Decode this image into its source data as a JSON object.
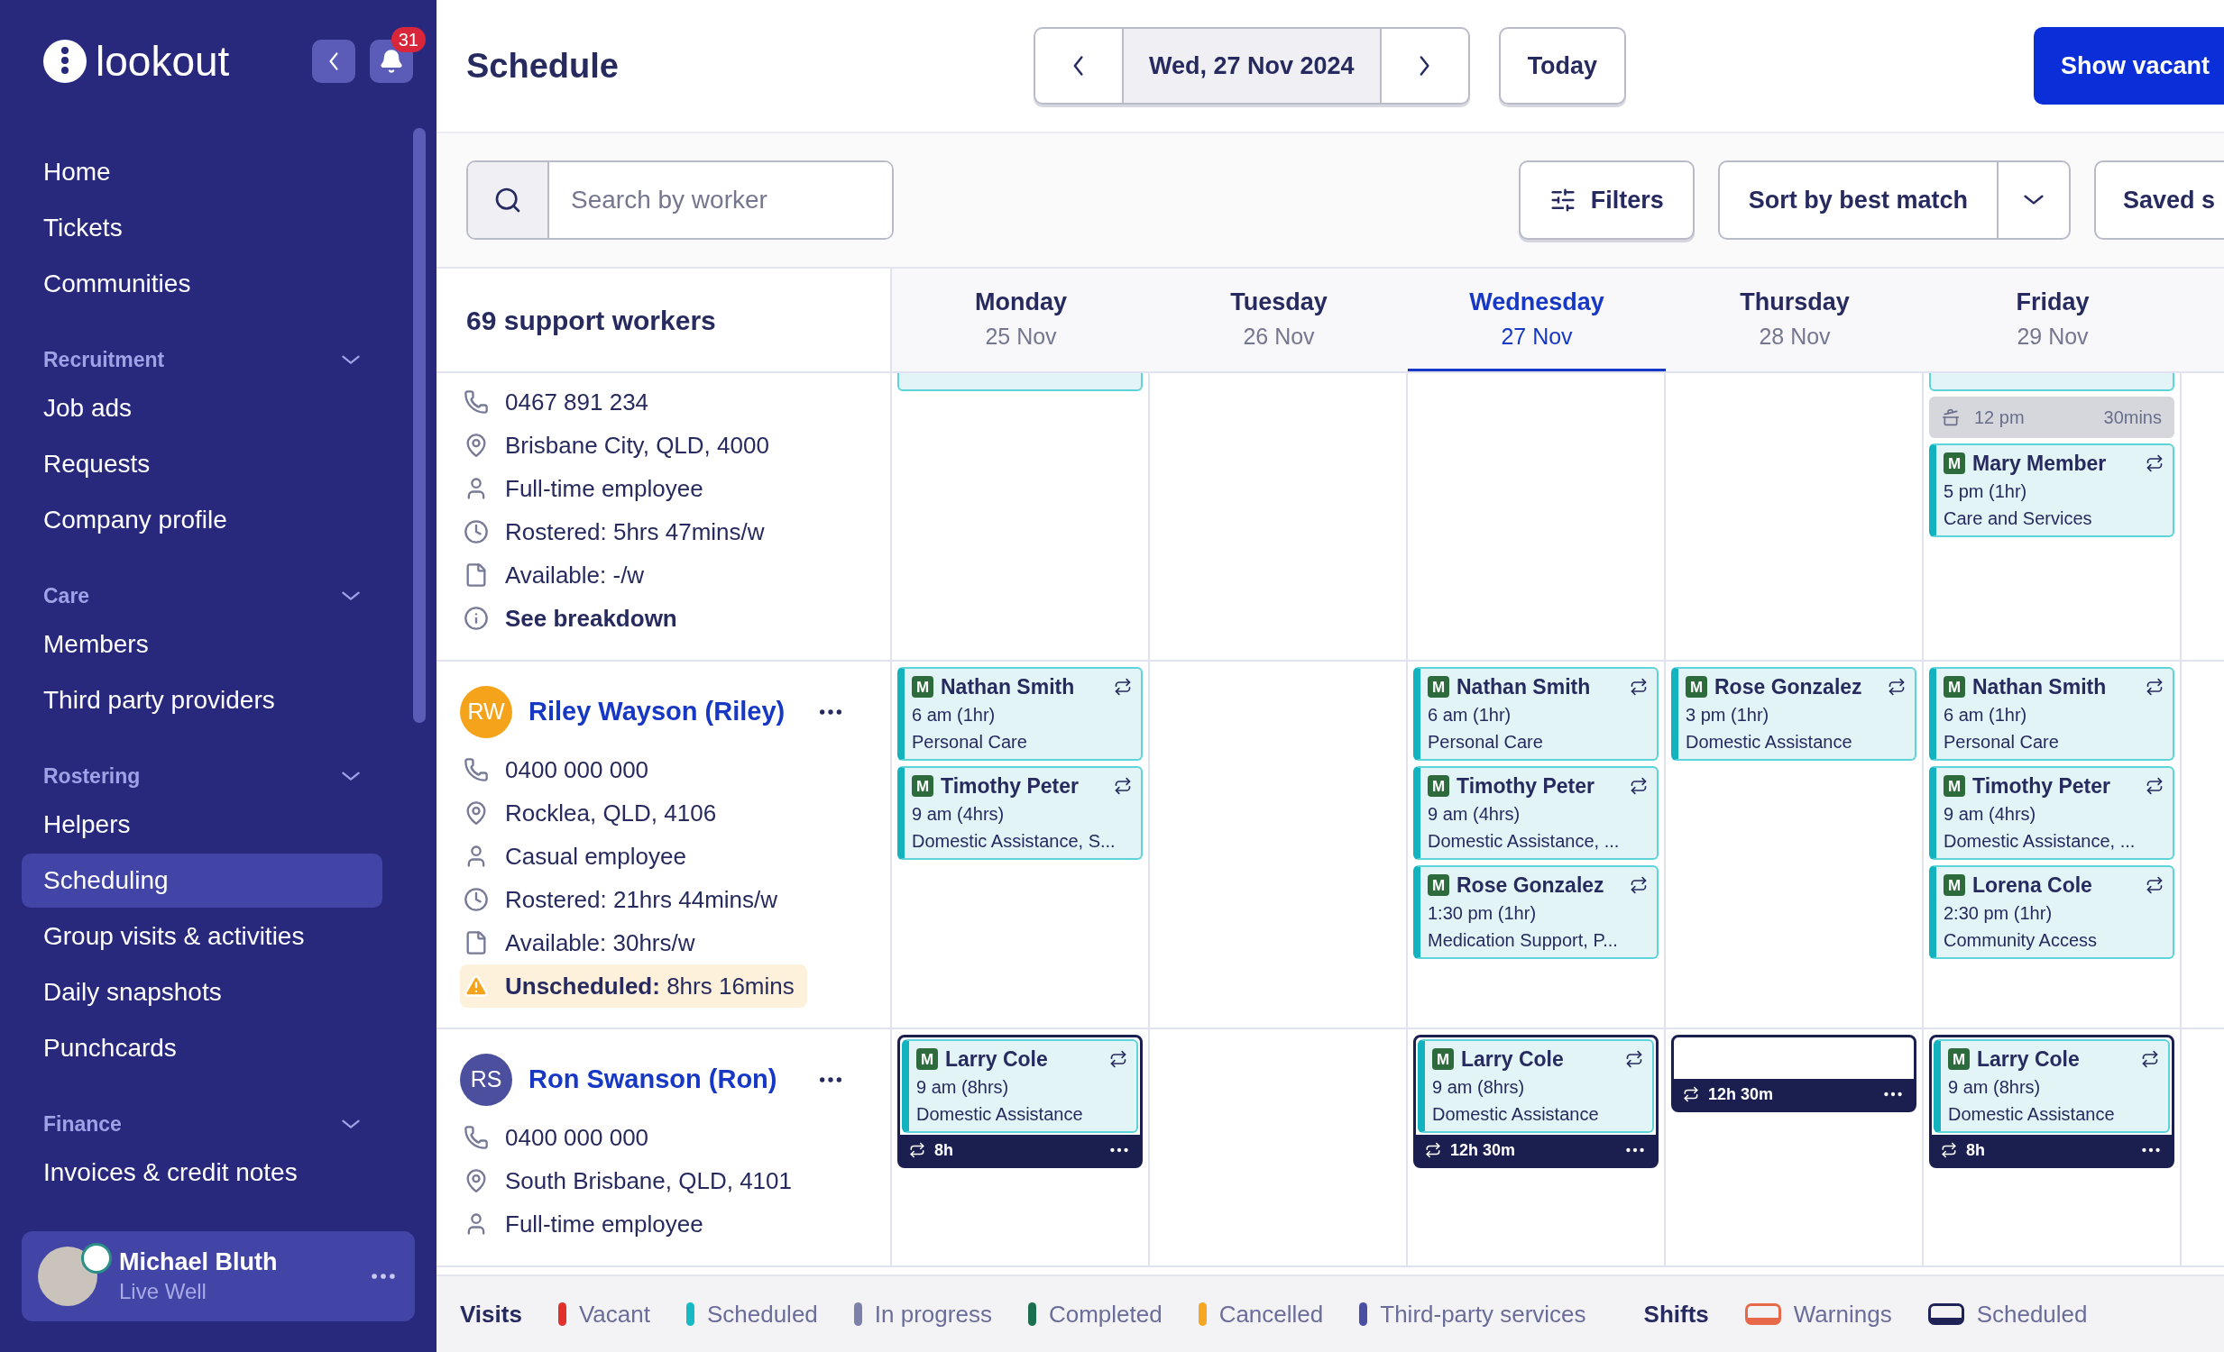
{
  "sidebar": {
    "logo": "lookout",
    "notification_count": "31",
    "sections": [
      {
        "items": [
          {
            "label": "Home",
            "selected": false
          },
          {
            "label": "Tickets",
            "selected": false
          },
          {
            "label": "Communities",
            "selected": false
          }
        ]
      },
      {
        "title": "Recruitment",
        "expanded": true,
        "items": [
          {
            "label": "Job ads",
            "selected": false
          },
          {
            "label": "Requests",
            "selected": false
          },
          {
            "label": "Company profile",
            "selected": false
          }
        ]
      },
      {
        "title": "Care",
        "expanded": true,
        "items": [
          {
            "label": "Members",
            "selected": false
          },
          {
            "label": "Third party providers",
            "selected": false
          }
        ]
      },
      {
        "title": "Rostering",
        "expanded": true,
        "items": [
          {
            "label": "Helpers",
            "selected": false
          },
          {
            "label": "Scheduling",
            "selected": true
          },
          {
            "label": "Group visits & activities",
            "selected": false
          },
          {
            "label": "Daily snapshots",
            "selected": false
          },
          {
            "label": "Punchcards",
            "selected": false
          }
        ]
      },
      {
        "title": "Finance",
        "expanded": true,
        "items": [
          {
            "label": "Invoices & credit notes",
            "selected": false
          }
        ]
      }
    ],
    "user": {
      "name": "Michael Bluth",
      "organisation": "Live Well"
    }
  },
  "header": {
    "title": "Schedule",
    "date": "Wed, 27 Nov 2024",
    "today_button": "Today",
    "primary_button": "Show vacant"
  },
  "toolbar": {
    "search": {
      "placeholder": "Search by worker"
    },
    "filters_button": "Filters",
    "sort": "Sort by best match",
    "saved_button": "Saved s"
  },
  "calendar": {
    "worker_count": "69 support workers",
    "days": [
      {
        "name": "Monday",
        "date": "25 Nov",
        "selected": false
      },
      {
        "name": "Tuesday",
        "date": "26 Nov",
        "selected": false
      },
      {
        "name": "Wednesday",
        "date": "27 Nov",
        "selected": true
      },
      {
        "name": "Thursday",
        "date": "28 Nov",
        "selected": false
      },
      {
        "name": "Friday",
        "date": "29 Nov",
        "selected": false
      }
    ],
    "workers": [
      {
        "details": [
          {
            "kind": "phone",
            "text": "0467 891 234"
          },
          {
            "kind": "location",
            "text": "Brisbane City, QLD, 4000"
          },
          {
            "kind": "person",
            "text": "Full-time employee"
          },
          {
            "kind": "clock",
            "text": "Rostered: 5hrs 47mins/w"
          },
          {
            "kind": "file",
            "text": "Available: -/w"
          },
          {
            "kind": "info",
            "text": "See breakdown"
          }
        ],
        "days": {
          "monday": {
            "entries": [
              {
                "kind": "stub"
              }
            ]
          },
          "friday": {
            "entries": [
              {
                "kind": "stub"
              },
              {
                "kind": "break",
                "time": "12 pm",
                "duration": "30mins"
              },
              {
                "kind": "visit",
                "badge": "M",
                "member": "Mary Member",
                "time": "5 pm (1hr)",
                "service": "Care and Services",
                "recurring": true
              }
            ]
          }
        }
      },
      {
        "initials": "RW",
        "name": "Riley Wayson (Riley)",
        "color": "#f5a31a",
        "details": [
          {
            "kind": "phone",
            "text": "0400 000 000"
          },
          {
            "kind": "location",
            "text": "Rocklea, QLD, 4106"
          },
          {
            "kind": "person",
            "text": "Casual employee"
          },
          {
            "kind": "clock",
            "text": "Rostered: 21hrs 44mins/w"
          },
          {
            "kind": "file",
            "text": "Available: 30hrs/w"
          },
          {
            "kind": "warning",
            "text": "**Unscheduled:** 8hrs 16mins"
          }
        ],
        "days": {
          "monday": {
            "entries": [
              {
                "kind": "visit",
                "badge": "M",
                "member": "Nathan Smith",
                "time": "6 am (1hr)",
                "service": "Personal Care",
                "recurring": true
              },
              {
                "kind": "visit",
                "badge": "M",
                "member": "Timothy Peter",
                "time": "9 am (4hrs)",
                "service": "Domestic Assistance, S...",
                "recurring": true
              }
            ]
          },
          "wednesday": {
            "entries": [
              {
                "kind": "visit",
                "badge": "M",
                "member": "Nathan Smith",
                "time": "6 am (1hr)",
                "service": "Personal Care",
                "recurring": true
              },
              {
                "kind": "visit",
                "badge": "M",
                "member": "Timothy Peter",
                "time": "9 am (4hrs)",
                "service": "Domestic Assistance, ...",
                "recurring": true
              },
              {
                "kind": "visit",
                "badge": "M",
                "member": "Rose Gonzalez",
                "time": "1:30 pm (1hr)",
                "service": "Medication Support, P...",
                "recurring": true
              }
            ]
          },
          "thursday": {
            "entries": [
              {
                "kind": "visit",
                "badge": "M",
                "member": "Rose Gonzalez",
                "time": "3 pm (1hr)",
                "service": "Domestic Assistance",
                "recurring": true
              }
            ]
          },
          "friday": {
            "entries": [
              {
                "kind": "visit",
                "badge": "M",
                "member": "Nathan Smith",
                "time": "6 am (1hr)",
                "service": "Personal Care",
                "recurring": true
              },
              {
                "kind": "visit",
                "badge": "M",
                "member": "Timothy Peter",
                "time": "9 am (4hrs)",
                "service": "Domestic Assistance, ...",
                "recurring": true
              },
              {
                "kind": "visit",
                "badge": "M",
                "member": "Lorena Cole",
                "time": "2:30 pm (1hr)",
                "service": "Community Access",
                "recurring": true
              }
            ]
          }
        }
      },
      {
        "initials": "RS",
        "name": "Ron Swanson (Ron)",
        "color": "#4b4f9e",
        "details": [
          {
            "kind": "phone",
            "text": "0400 000 000"
          },
          {
            "kind": "location",
            "text": "South Brisbane, QLD, 4101"
          },
          {
            "kind": "person",
            "text": "Full-time employee"
          }
        ],
        "days": {
          "monday": {
            "entries": [
              {
                "kind": "shift",
                "duration": "8h",
                "visits": [
                  {
                    "badge": "M",
                    "member": "Larry Cole",
                    "time": "9 am (8hrs)",
                    "service": "Domestic Assistance",
                    "recurring": true
                  }
                ]
              }
            ]
          },
          "wednesday": {
            "entries": [
              {
                "kind": "shift",
                "duration": "12h 30m",
                "visits": [
                  {
                    "badge": "M",
                    "member": "Larry Cole",
                    "time": "9 am (8hrs)",
                    "service": "Domestic Assistance",
                    "recurring": true
                  }
                ]
              }
            ]
          },
          "thursday": {
            "entries": [
              {
                "kind": "shift",
                "duration": "12h 30m"
              }
            ]
          },
          "friday": {
            "entries": [
              {
                "kind": "shift",
                "duration": "8h",
                "visits": [
                  {
                    "badge": "M",
                    "member": "Larry Cole",
                    "time": "9 am (8hrs)",
                    "service": "Domestic Assistance",
                    "recurring": true
                  }
                ]
              }
            ]
          }
        }
      }
    ]
  },
  "legend": {
    "groups": [
      {
        "title": "Visits",
        "items": [
          {
            "label": "Vacant",
            "kind": "bar",
            "color": "#e0322d"
          },
          {
            "label": "Scheduled",
            "kind": "bar",
            "color": "#17b9c4"
          },
          {
            "label": "In progress",
            "kind": "bar",
            "color": "#7d80a8"
          },
          {
            "label": "Completed",
            "kind": "bar",
            "color": "#1b6e50"
          },
          {
            "label": "Cancelled",
            "kind": "bar",
            "color": "#f5a623"
          },
          {
            "label": "Third-party services",
            "kind": "bar",
            "color": "#4b4fa3"
          }
        ]
      },
      {
        "title": "Shifts",
        "items": [
          {
            "label": "Warnings",
            "kind": "outline",
            "color": "#e8694a"
          },
          {
            "label": "Scheduled",
            "kind": "outline",
            "color": "#1e2257"
          }
        ]
      }
    ]
  }
}
